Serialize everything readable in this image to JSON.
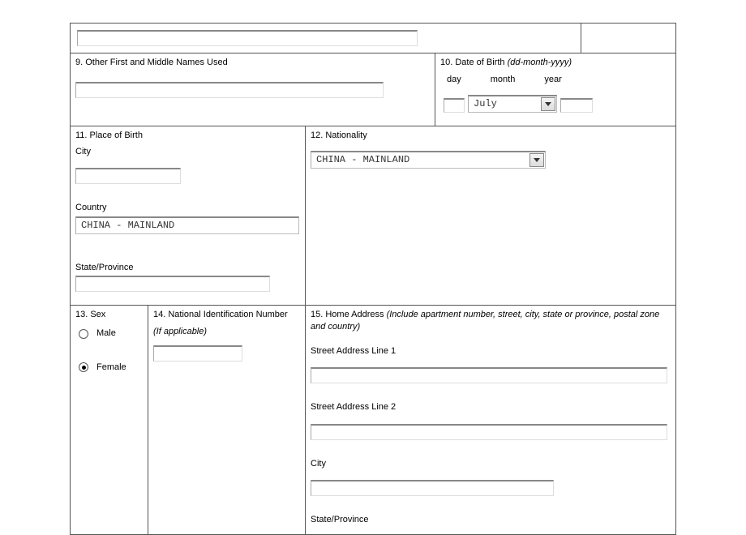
{
  "section9": {
    "label": "9. Other First and Middle Names Used",
    "value": ""
  },
  "section10": {
    "label": "10. Date of Birth",
    "format": "(dd-month-yyyy)",
    "day_label": "day",
    "month_label": "month",
    "year_label": "year",
    "month_value": "July"
  },
  "section11": {
    "label": "11. Place of Birth",
    "city_label": "City",
    "city_value": "",
    "country_label": "Country",
    "country_value": "CHINA - MAINLAND",
    "state_label": "State/Province",
    "state_value": ""
  },
  "section12": {
    "label": "12. Nationality",
    "value": "CHINA - MAINLAND"
  },
  "section13": {
    "label": "13. Sex",
    "male_label": "Male",
    "female_label": "Female",
    "selected": "Female"
  },
  "section14": {
    "label": "14. National Identification Number",
    "sub": "(If applicable)",
    "value": ""
  },
  "section15": {
    "label": "15. Home Address",
    "sub": "(Include apartment number, street, city, state or province, postal zone and country)",
    "line1_label": "Street Address Line 1",
    "line1_value": "",
    "line2_label": "Street Address Line 2",
    "line2_value": "",
    "city_label": "City",
    "city_value": "",
    "state_label": "State/Province"
  }
}
